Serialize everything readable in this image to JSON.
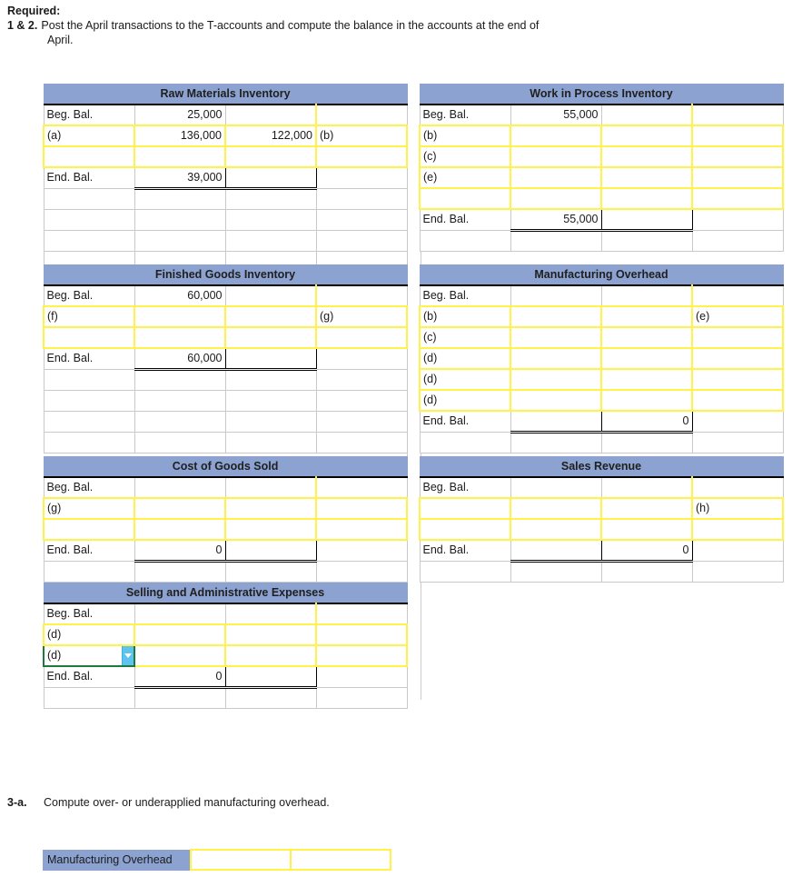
{
  "intro": {
    "required_label": "Required:",
    "item_number": "1 & 2.",
    "item_text": "Post the April transactions to the T-accounts and compute the balance in the accounts at the end of",
    "item_text_cont": "April."
  },
  "colors": {
    "header_blue": "#8CA2D1",
    "input_yellow": "#FFF24A",
    "dropdown_blue": "#5FC3F0",
    "selected_green": "#1D7A3C"
  },
  "accounts": [
    {
      "id": "raw-materials-inventory",
      "title": "Raw Materials Inventory",
      "rows": [
        {
          "type": "beg",
          "label": "Beg. Bal.",
          "debit": "25,000",
          "credit": "",
          "credit_label": ""
        },
        {
          "type": "entry",
          "label": "(a)",
          "debit": "136,000",
          "credit": "122,000",
          "credit_label": "(b)"
        },
        {
          "type": "entry",
          "label": "",
          "debit": "",
          "credit": "",
          "credit_label": ""
        },
        {
          "type": "end",
          "label": "End. Bal.",
          "debit": "39,000",
          "credit": "",
          "credit_label": ""
        }
      ],
      "filler_rows": 4
    },
    {
      "id": "work-in-process-inventory",
      "title": "Work in Process Inventory",
      "rows": [
        {
          "type": "beg",
          "label": "Beg. Bal.",
          "debit": "55,000",
          "credit": "",
          "credit_label": ""
        },
        {
          "type": "entry",
          "label": "(b)",
          "debit": "",
          "credit": "",
          "credit_label": ""
        },
        {
          "type": "entry",
          "label": "(c)",
          "debit": "",
          "credit": "",
          "credit_label": ""
        },
        {
          "type": "entry",
          "label": "(e)",
          "debit": "",
          "credit": "",
          "credit_label": ""
        },
        {
          "type": "entry",
          "label": "",
          "debit": "",
          "credit": "",
          "credit_label": ""
        },
        {
          "type": "end",
          "label": "End. Bal.",
          "debit": "55,000",
          "credit": "",
          "credit_label": ""
        }
      ],
      "filler_rows": 1
    },
    {
      "id": "finished-goods-inventory",
      "title": "Finished Goods Inventory",
      "rows": [
        {
          "type": "beg",
          "label": "Beg. Bal.",
          "debit": "60,000",
          "credit": "",
          "credit_label": ""
        },
        {
          "type": "entry",
          "label": "(f)",
          "debit": "",
          "credit": "",
          "credit_label": "(g)"
        },
        {
          "type": "entry",
          "label": "",
          "debit": "",
          "credit": "",
          "credit_label": ""
        },
        {
          "type": "end",
          "label": "End. Bal.",
          "debit": "60,000",
          "credit": "",
          "credit_label": ""
        }
      ],
      "filler_rows": 4
    },
    {
      "id": "manufacturing-overhead",
      "title": "Manufacturing Overhead",
      "rows": [
        {
          "type": "beg",
          "label": "Beg. Bal.",
          "debit": "",
          "credit": "",
          "credit_label": ""
        },
        {
          "type": "entry",
          "label": "(b)",
          "debit": "",
          "credit": "",
          "credit_label": "(e)"
        },
        {
          "type": "entry",
          "label": "(c)",
          "debit": "",
          "credit": "",
          "credit_label": ""
        },
        {
          "type": "entry",
          "label": "(d)",
          "debit": "",
          "credit": "",
          "credit_label": ""
        },
        {
          "type": "entry",
          "label": "(d)",
          "debit": "",
          "credit": "",
          "credit_label": ""
        },
        {
          "type": "entry",
          "label": "(d)",
          "debit": "",
          "credit": "",
          "credit_label": ""
        },
        {
          "type": "end",
          "label": "End. Bal.",
          "debit": "",
          "credit": "0",
          "credit_label": ""
        }
      ],
      "filler_rows": 1
    },
    {
      "id": "cost-of-goods-sold",
      "title": "Cost of Goods Sold",
      "rows": [
        {
          "type": "beg",
          "label": "Beg. Bal.",
          "debit": "",
          "credit": "",
          "credit_label": ""
        },
        {
          "type": "entry",
          "label": "(g)",
          "debit": "",
          "credit": "",
          "credit_label": ""
        },
        {
          "type": "entry",
          "label": "",
          "debit": "",
          "credit": "",
          "credit_label": ""
        },
        {
          "type": "end",
          "label": "End. Bal.",
          "debit": "0",
          "credit": "",
          "credit_label": ""
        }
      ],
      "filler_rows": 1
    },
    {
      "id": "sales-revenue",
      "title": "Sales Revenue",
      "rows": [
        {
          "type": "beg",
          "label": "Beg. Bal.",
          "debit": "",
          "credit": "",
          "credit_label": ""
        },
        {
          "type": "entry",
          "label": "",
          "debit": "",
          "credit": "",
          "credit_label": "(h)"
        },
        {
          "type": "entry",
          "label": "",
          "debit": "",
          "credit": "",
          "credit_label": ""
        },
        {
          "type": "end",
          "label": "End. Bal.",
          "debit": "",
          "credit": "0",
          "credit_label": ""
        }
      ],
      "filler_rows": 1
    },
    {
      "id": "selling-and-administrative-expenses",
      "title": "Selling and Administrative Expenses",
      "rows": [
        {
          "type": "beg",
          "label": "Beg. Bal.",
          "debit": "",
          "credit": "",
          "credit_label": ""
        },
        {
          "type": "entry",
          "label": "(d)",
          "debit": "",
          "credit": "",
          "credit_label": ""
        },
        {
          "type": "entry-selected",
          "label": "(d)",
          "debit": "",
          "credit": "",
          "credit_label": ""
        },
        {
          "type": "end",
          "label": "End. Bal.",
          "debit": "0",
          "credit": "",
          "credit_label": ""
        }
      ],
      "filler_rows": 1
    }
  ],
  "part3a": {
    "number": "3-a.",
    "text": "Compute over- or underapplied manufacturing overhead.",
    "row_label": "Manufacturing Overhead",
    "value_1": "",
    "value_2": ""
  },
  "icons": {
    "dropdown": "chevron-down-icon"
  }
}
